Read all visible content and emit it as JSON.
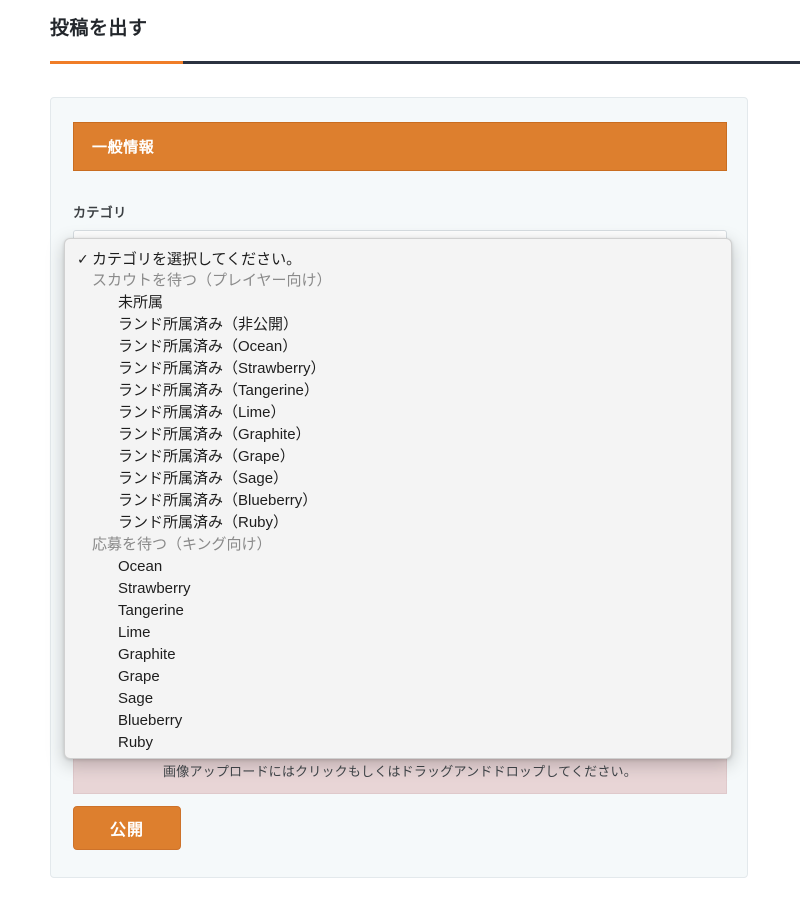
{
  "page": {
    "title": "投稿を出す",
    "accent_color": "#f07d28",
    "rule_color": "#2b3240"
  },
  "card": {
    "banner": {
      "label": "一般情報",
      "background": "#dd7f2e"
    },
    "fields": [
      {
        "name": "category",
        "label": "カテゴリ",
        "value": "カテゴリを選択してください。",
        "kind": "select"
      },
      {
        "name": "title",
        "label": "",
        "value": "",
        "placeholder": "",
        "kind": "text"
      },
      {
        "name": "body",
        "label": "",
        "value": "",
        "placeholder": "",
        "kind": "textarea"
      }
    ],
    "upload_band": {
      "text": "画像アップロードにはクリックもしくはドラッグアンドドロップしてください。",
      "background": "#e8d5d6"
    },
    "publish_button": {
      "label": "公開",
      "background": "#dd7f2e"
    }
  },
  "select_popup": {
    "check_glyph": "✓",
    "rows": [
      {
        "text": "カテゴリを選択してください。",
        "type": "selected"
      },
      {
        "text": "スカウトを待つ（プレイヤー向け）",
        "type": "group"
      },
      {
        "text": "未所属",
        "type": "option"
      },
      {
        "text": "ランド所属済み（非公開）",
        "type": "option"
      },
      {
        "text": "ランド所属済み（Ocean）",
        "type": "option"
      },
      {
        "text": "ランド所属済み（Strawberry）",
        "type": "option"
      },
      {
        "text": "ランド所属済み（Tangerine）",
        "type": "option"
      },
      {
        "text": "ランド所属済み（Lime）",
        "type": "option"
      },
      {
        "text": "ランド所属済み（Graphite）",
        "type": "option"
      },
      {
        "text": "ランド所属済み（Grape）",
        "type": "option"
      },
      {
        "text": "ランド所属済み（Sage）",
        "type": "option"
      },
      {
        "text": "ランド所属済み（Blueberry）",
        "type": "option"
      },
      {
        "text": "ランド所属済み（Ruby）",
        "type": "option"
      },
      {
        "text": "応募を待つ（キング向け）",
        "type": "group"
      },
      {
        "text": "Ocean",
        "type": "option"
      },
      {
        "text": "Strawberry",
        "type": "option"
      },
      {
        "text": "Tangerine",
        "type": "option"
      },
      {
        "text": "Lime",
        "type": "option"
      },
      {
        "text": "Graphite",
        "type": "option"
      },
      {
        "text": "Grape",
        "type": "option"
      },
      {
        "text": "Sage",
        "type": "option"
      },
      {
        "text": "Blueberry",
        "type": "option"
      },
      {
        "text": "Ruby",
        "type": "option"
      }
    ]
  }
}
